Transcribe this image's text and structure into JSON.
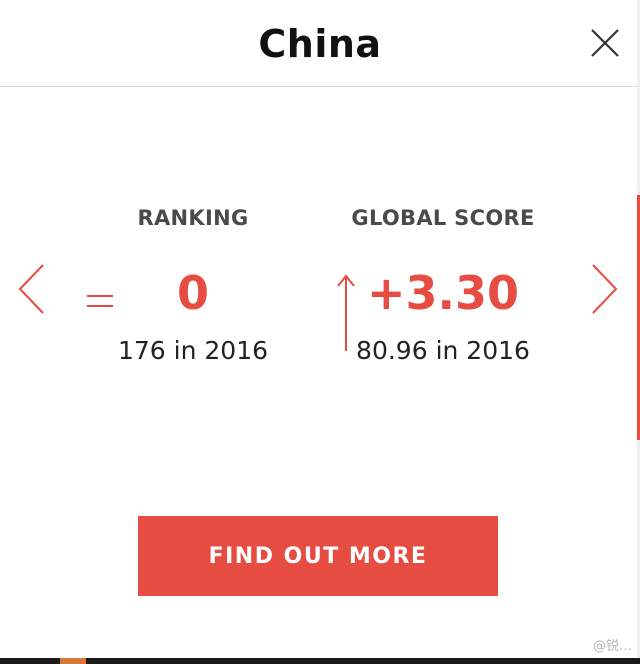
{
  "header": {
    "title": "China",
    "close_icon": "close-icon"
  },
  "stats": {
    "ranking": {
      "label": "RANKING",
      "change": "0",
      "change_icon": "equal-icon",
      "previous": "176 in 2016"
    },
    "global_score": {
      "label": "GLOBAL SCORE",
      "change": "+3.30",
      "change_icon": "arrow-up-icon",
      "previous": "80.96 in 2016"
    }
  },
  "nav": {
    "prev_icon": "chevron-left-icon",
    "next_icon": "chevron-right-icon"
  },
  "cta": {
    "label": "FIND OUT MORE"
  },
  "watermark": "@锐…",
  "colors": {
    "accent": "#e74c42",
    "label_gray": "#4a4a4a",
    "text_dark": "#222222"
  }
}
